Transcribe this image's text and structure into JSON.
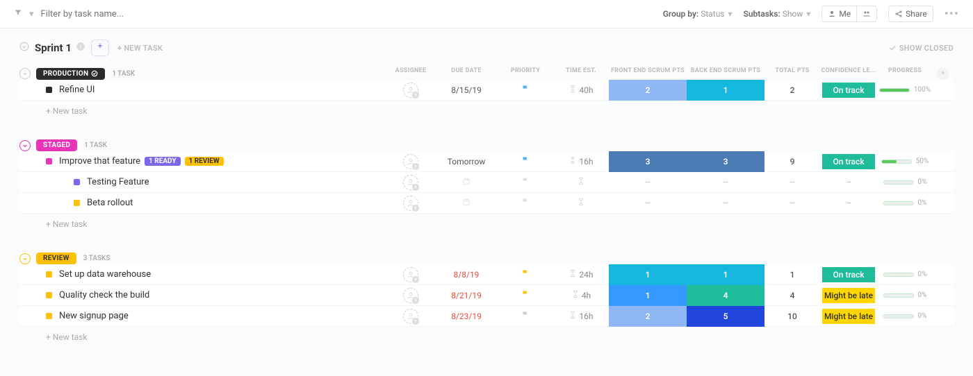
{
  "topBar": {
    "filterPlaceholder": "Filter by task name...",
    "groupByLabel": "Group by:",
    "groupByValue": "Status",
    "subtasksLabel": "Subtasks:",
    "subtasksValue": "Show",
    "meLabel": "Me",
    "shareLabel": "Share"
  },
  "sprint": {
    "title": "Sprint 1",
    "newTaskLabel": "+ NEW TASK",
    "showClosed": "SHOW CLOSED"
  },
  "columns": {
    "assignee": "ASSIGNEE",
    "dueDate": "DUE DATE",
    "priority": "PRIORITY",
    "timeEst": "TIME EST.",
    "feScrum": "FRONT END SCRUM PTS",
    "beScrum": "BACK END SCRUM PTS",
    "totalPts": "TOTAL PTS",
    "confidence": "CONFIDENCE LE...",
    "progress": "PROGRESS"
  },
  "groups": [
    {
      "name": "PRODUCTION",
      "pillClass": "production",
      "chevClass": "",
      "count": "1 TASK",
      "showHeaders": true,
      "tasks": [
        {
          "dot": "black-dot",
          "name": "Refine UI",
          "tags": [],
          "dueDate": "8/15/19",
          "overdue": false,
          "flag": "flag-blue",
          "timeEst": "40h",
          "fe": {
            "val": "2",
            "cls": "scrum-lightblue"
          },
          "be": {
            "val": "1",
            "cls": "scrum-cyan"
          },
          "total": "2",
          "conf": {
            "label": "On track",
            "cls": "conf-ontrack"
          },
          "progress": {
            "pct": 100,
            "label": "100%"
          },
          "subtask": false
        }
      ],
      "newTask": "+ New task"
    },
    {
      "name": "STAGED",
      "pillClass": "staged",
      "chevClass": "pink",
      "count": "1 TASK",
      "showHeaders": false,
      "tasks": [
        {
          "dot": "pink-dot",
          "name": "Improve that feature",
          "tags": [
            {
              "label": "1 READY",
              "cls": "tag-ready"
            },
            {
              "label": "1 REVIEW",
              "cls": "tag-review"
            }
          ],
          "dueDate": "Tomorrow",
          "overdue": false,
          "flag": "flag-blue",
          "timeEst": "16h",
          "fe": {
            "val": "3",
            "cls": "scrum-darkblue"
          },
          "be": {
            "val": "3",
            "cls": "scrum-darkblue"
          },
          "total": "9",
          "conf": {
            "label": "On track",
            "cls": "conf-ontrack"
          },
          "progress": {
            "pct": 50,
            "label": "50%"
          },
          "subtask": false
        },
        {
          "dot": "purple-dot",
          "name": "Testing Feature",
          "tags": [],
          "dueDate": "",
          "overdue": false,
          "flag": "flag-outline",
          "timeEst": "",
          "fe": {
            "val": "–",
            "cls": ""
          },
          "be": {
            "val": "–",
            "cls": ""
          },
          "total": "–",
          "conf": {
            "label": "–",
            "cls": ""
          },
          "progress": {
            "pct": 0,
            "label": "0%"
          },
          "subtask": true
        },
        {
          "dot": "yellow-dot",
          "name": "Beta rollout",
          "tags": [],
          "dueDate": "",
          "overdue": false,
          "flag": "flag-outline",
          "timeEst": "",
          "fe": {
            "val": "–",
            "cls": ""
          },
          "be": {
            "val": "–",
            "cls": ""
          },
          "total": "–",
          "conf": {
            "label": "–",
            "cls": ""
          },
          "progress": {
            "pct": 0,
            "label": "0%"
          },
          "subtask": true
        }
      ],
      "newTask": "+ New task"
    },
    {
      "name": "REVIEW",
      "pillClass": "review",
      "chevClass": "yellow",
      "count": "3 TASKS",
      "showHeaders": false,
      "tasks": [
        {
          "dot": "yellow-dot",
          "name": "Set up data warehouse",
          "tags": [],
          "dueDate": "8/8/19",
          "overdue": true,
          "flag": "flag-yellow",
          "timeEst": "24h",
          "fe": {
            "val": "1",
            "cls": "scrum-cyan"
          },
          "be": {
            "val": "1",
            "cls": "scrum-cyan"
          },
          "total": "1",
          "conf": {
            "label": "On track",
            "cls": "conf-ontrack"
          },
          "progress": {
            "pct": 0,
            "label": "0%"
          },
          "subtask": false
        },
        {
          "dot": "yellow-dot",
          "name": "Quality check the build",
          "tags": [],
          "dueDate": "8/21/19",
          "overdue": true,
          "flag": "flag-yellow",
          "timeEst": "4h",
          "fe": {
            "val": "1",
            "cls": "scrum-brightblue"
          },
          "be": {
            "val": "4",
            "cls": "scrum-teal"
          },
          "total": "4",
          "conf": {
            "label": "Might be late",
            "cls": "conf-late"
          },
          "progress": {
            "pct": 0,
            "label": "0%"
          },
          "subtask": false
        },
        {
          "dot": "yellow-dot",
          "name": "New signup page",
          "tags": [],
          "dueDate": "8/23/19",
          "overdue": true,
          "flag": "flag-grey",
          "timeEst": "16h",
          "fe": {
            "val": "2",
            "cls": "scrum-lightblue"
          },
          "be": {
            "val": "5",
            "cls": "scrum-royal"
          },
          "total": "10",
          "conf": {
            "label": "Might be late",
            "cls": "conf-late"
          },
          "progress": {
            "pct": 0,
            "label": "0%"
          },
          "subtask": false
        }
      ],
      "newTask": "+ New task"
    }
  ]
}
